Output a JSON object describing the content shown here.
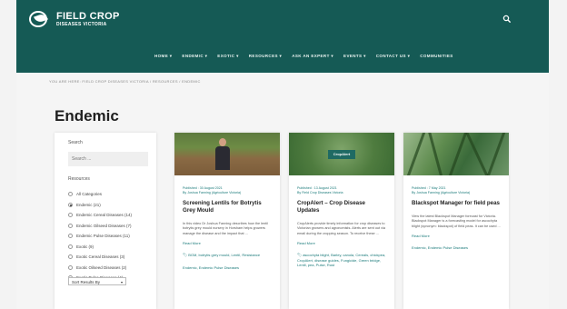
{
  "header": {
    "logo_line1": "FIELD CROP",
    "logo_line2": "DISEASES VICTORIA",
    "nav": [
      "HOME ▾",
      "ENDEMIC ▾",
      "EXOTIC ▾",
      "RESOURCES ▾",
      "ASK AN EXPERT ▾",
      "EVENTS ▾",
      "CONTACT US ▾",
      "COMMUNITIES"
    ]
  },
  "breadcrumb": "YOU ARE HERE: FIELD CROP DISEASES VICTORIA  /  RESOURCES  /  ENDEMIC",
  "page_title": "Endemic",
  "sidebar": {
    "search_label": "Search",
    "search_placeholder": "Search ...",
    "resources_label": "Resources",
    "filters": [
      {
        "label": "All Categories",
        "selected": false
      },
      {
        "label": "Endemic (21)",
        "selected": true
      },
      {
        "label": "Endemic Cereal Diseases (14)",
        "selected": false
      },
      {
        "label": "Endemic Oilseed Diseases (7)",
        "selected": false
      },
      {
        "label": "Endemic Pulse Diseases (11)",
        "selected": false
      },
      {
        "label": "Exotic (9)",
        "selected": false
      },
      {
        "label": "Exotic Cereal Diseases (3)",
        "selected": false
      },
      {
        "label": "Exotic Oilseed Diseases (2)",
        "selected": false
      },
      {
        "label": "Exotic Pulse Diseases (4)",
        "selected": false
      }
    ],
    "sort_label": "Sort Results By"
  },
  "cards": [
    {
      "meta1": "Published : 30 August 2021",
      "meta2": "By Joshua Fanning (Agriculture Victoria)",
      "title": "Screening Lentils for Botrytis Grey Mould",
      "excerpt": "In this video Dr Joshua Fanning describes how the lentil botrytis grey mould nursery in Horsham helps growers manage the disease and the impact that ...",
      "more": "Read More",
      "tags": "BGM, botrytis grey mould, Lentil, Resistance",
      "cats": "Endemic, Endemic Pulse Diseases"
    },
    {
      "meta1": "Published : 13 August 2021",
      "meta2": "By Field Crop Diseases Victoria",
      "title": "CropAlert – Crop Disease Updates",
      "badge": "CropAlert",
      "excerpt": "CropAlerts provide timely information for crop diseases to Victorian growers and agronomists. Alerts are sent out via email during the cropping season. To receive these ...",
      "more": "Read More",
      "tags": "ascochyta blight, Barley, canola, Cereals, chickpea, CropAlert, disease guides, Fungicide, Green bridge, Lentil, pea, Pulse, Rust",
      "cats": ""
    },
    {
      "meta1": "Published : 7 May 2021",
      "meta2": "By Joshua Fanning (Agriculture Victoria)",
      "title": "Blackspot Manager for field peas",
      "excerpt": "View the latest Blackspot Manager forecast for Victoria. Blackspot Manager is a forecasting model for ascochyta blight (synonym: blackspot) of field peas. It can be used ...",
      "more": "Read More",
      "tags": "",
      "cats": "Endemic, Endemic Pulse Diseases"
    }
  ],
  "colors": {
    "header_bg": "#155a55",
    "accent": "#1a7a7a"
  },
  "icons": {
    "search": "search-icon",
    "logo": "logo-icon"
  }
}
